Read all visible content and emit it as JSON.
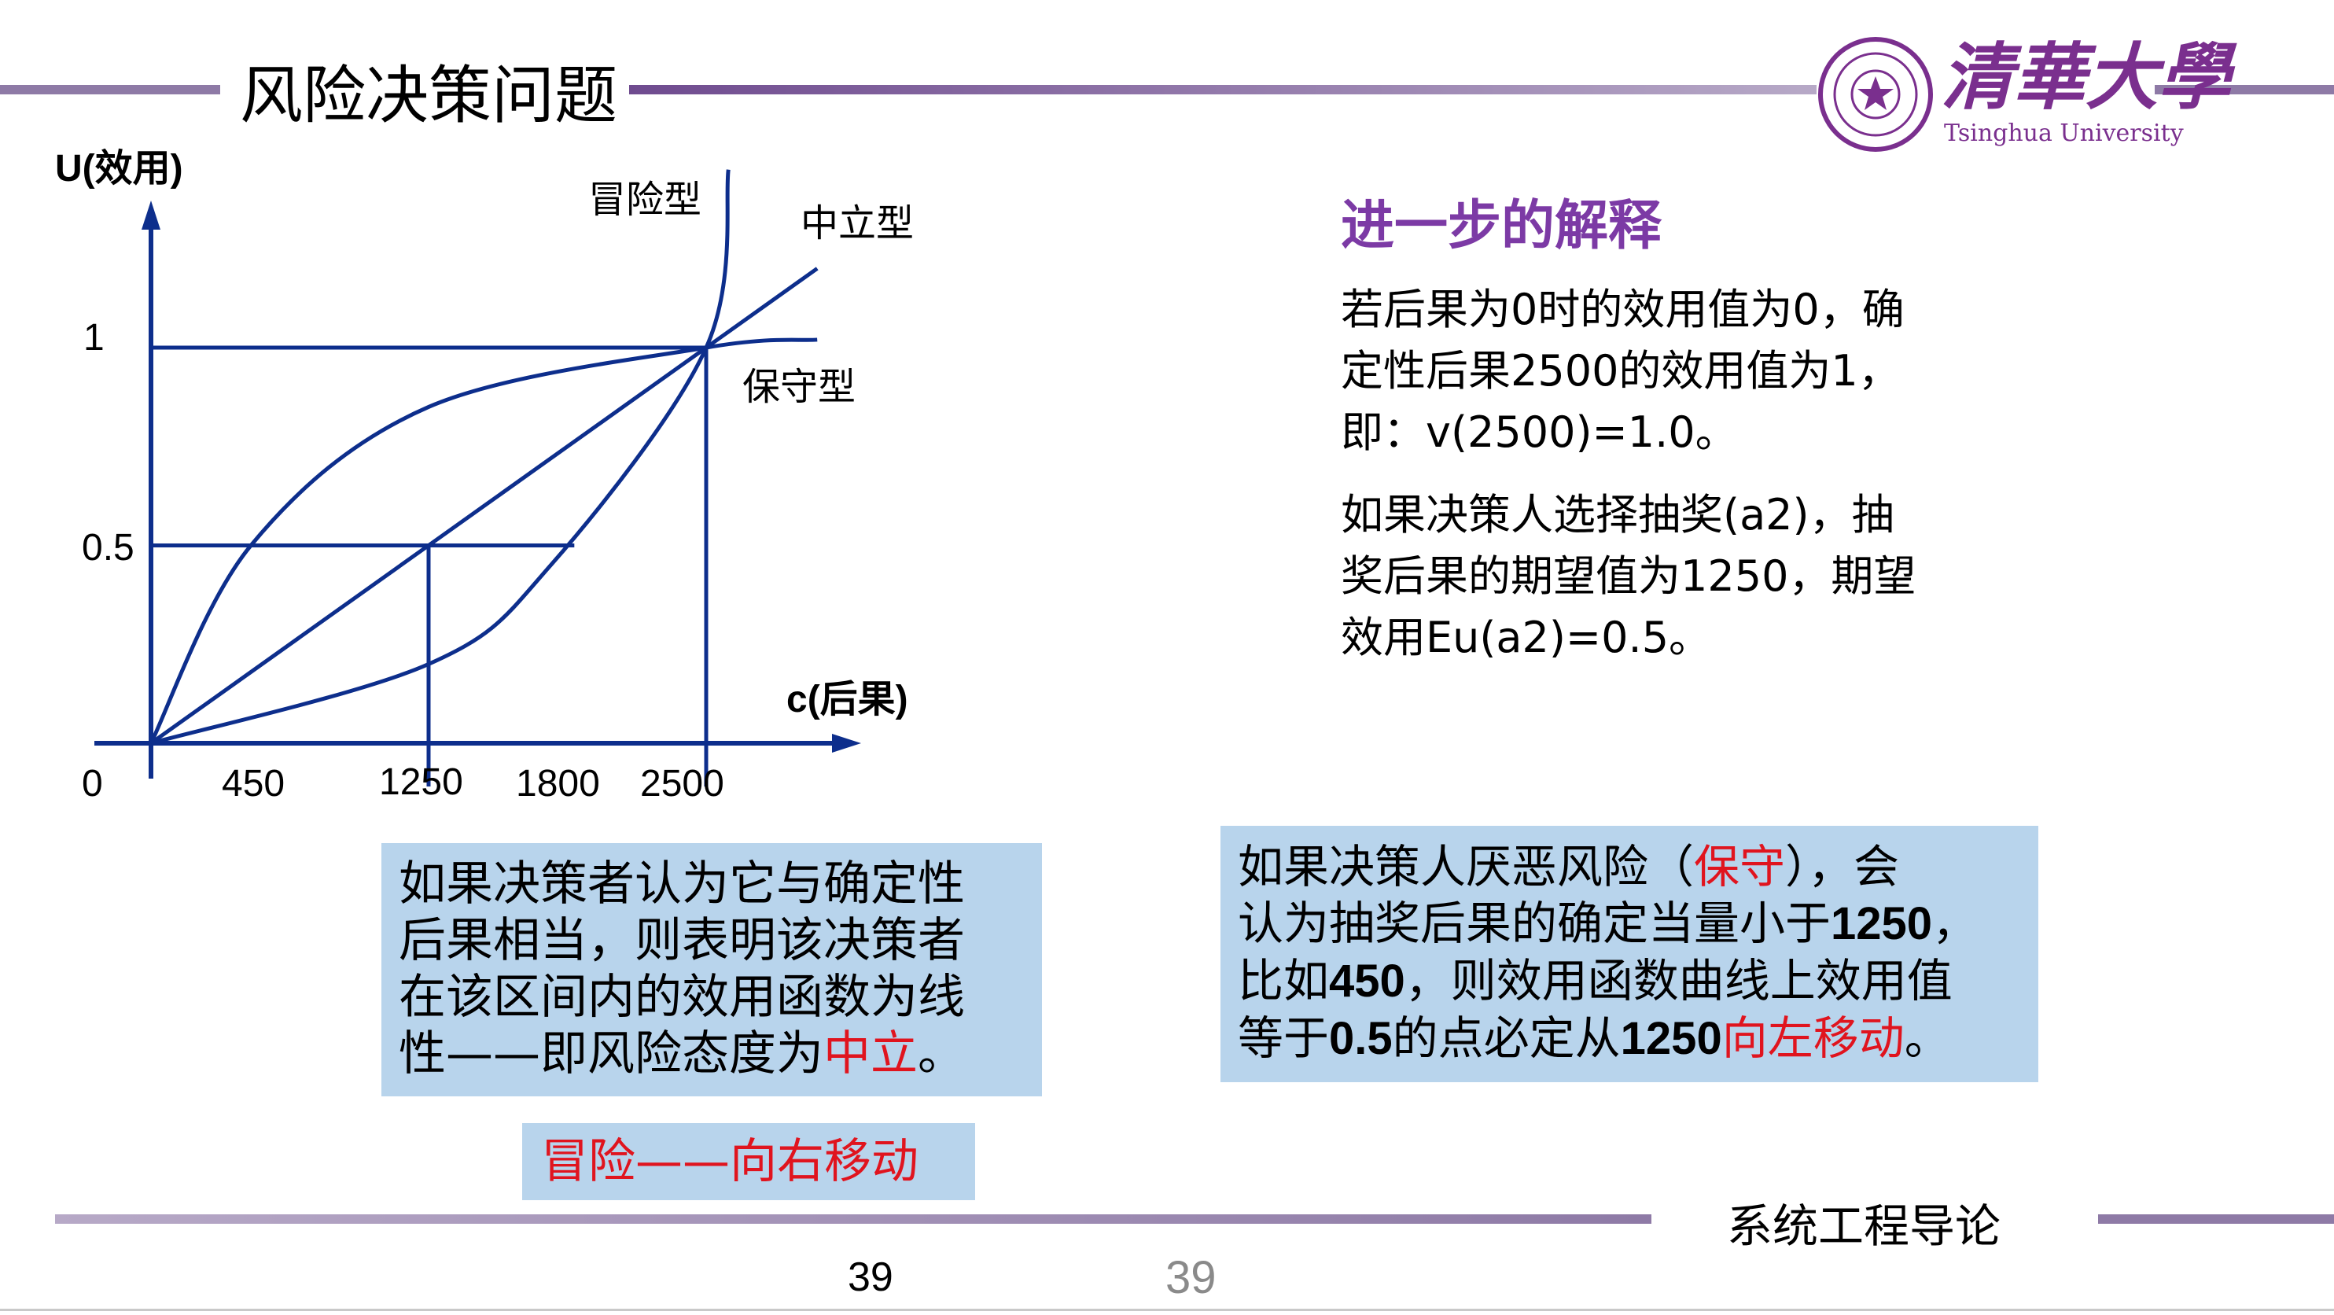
{
  "slide": {
    "title": "风险决策问题",
    "logo": {
      "cn": "清華大學",
      "en": "Tsinghua University"
    }
  },
  "chart_data": {
    "type": "line",
    "ylabel": "U(效用)",
    "xlabel": "c(后果)",
    "y_ticks": [
      "1",
      "0.5"
    ],
    "x_ticks": [
      "0",
      "450",
      "1250",
      "1800",
      "2500"
    ],
    "series": [
      {
        "name": "冒险型",
        "points": [
          [
            0,
            0
          ],
          [
            1250,
            0.2
          ],
          [
            1800,
            0.45
          ],
          [
            2500,
            1.0
          ],
          [
            2600,
            1.45
          ]
        ]
      },
      {
        "name": "中立型",
        "points": [
          [
            0,
            0
          ],
          [
            1250,
            0.5
          ],
          [
            2500,
            1.0
          ],
          [
            3000,
            1.2
          ]
        ]
      },
      {
        "name": "保守型",
        "points": [
          [
            0,
            0
          ],
          [
            450,
            0.5
          ],
          [
            1250,
            0.85
          ],
          [
            2500,
            1.0
          ],
          [
            3000,
            1.02
          ]
        ]
      }
    ],
    "reference_lines": [
      {
        "y": 1,
        "x": 2500
      },
      {
        "y": 0.5,
        "x": 1250
      }
    ]
  },
  "right_text": {
    "heading": "进一步的解释",
    "para1": [
      "若后果为0时的效用值为0，确",
      "定性后果2500的效用值为1，",
      "即：v(2500)=1.0。"
    ],
    "para2": [
      "如果决策人选择抽奖(a2)，抽",
      "奖后果的期望值为1250，期望",
      "效用Eu(a2)=0.5。"
    ]
  },
  "box_left": {
    "line1": "如果决策者认为它与确定性",
    "line2": "后果相当，则表明该决策者",
    "line3": "在该区间内的效用函数为线",
    "line4_pre": "性——即风险态度为",
    "line4_red": "中立",
    "line4_post": "。"
  },
  "box_risk": {
    "text": "冒险——向右移动"
  },
  "box_right": {
    "l1_pre": "如果决策人厌恶风险（",
    "l1_red": "保守",
    "l1_post": "），会",
    "l2_pre": "认为抽奖后果的确定当量小于",
    "l2_bold": "1250",
    "l2_post": "，",
    "l3_pre": "比如",
    "l3_bold": "450",
    "l3_post": "，则效用函数曲线上效用值",
    "l4_pre": "等于",
    "l4_bold1": "0.5",
    "l4_mid": "的点必定从",
    "l4_bold2": "1250",
    "l4_red": "向左移动",
    "l4_post": "。"
  },
  "footer": {
    "course": "系统工程导论",
    "page_left": "39",
    "page_right": "39"
  },
  "colors": {
    "accent_purple": "#7c3aa5",
    "rule": "#8e7aa6",
    "curve": "#0d2e8c",
    "box_bg": "#b8d4ec",
    "highlight_red": "#e0141e"
  }
}
